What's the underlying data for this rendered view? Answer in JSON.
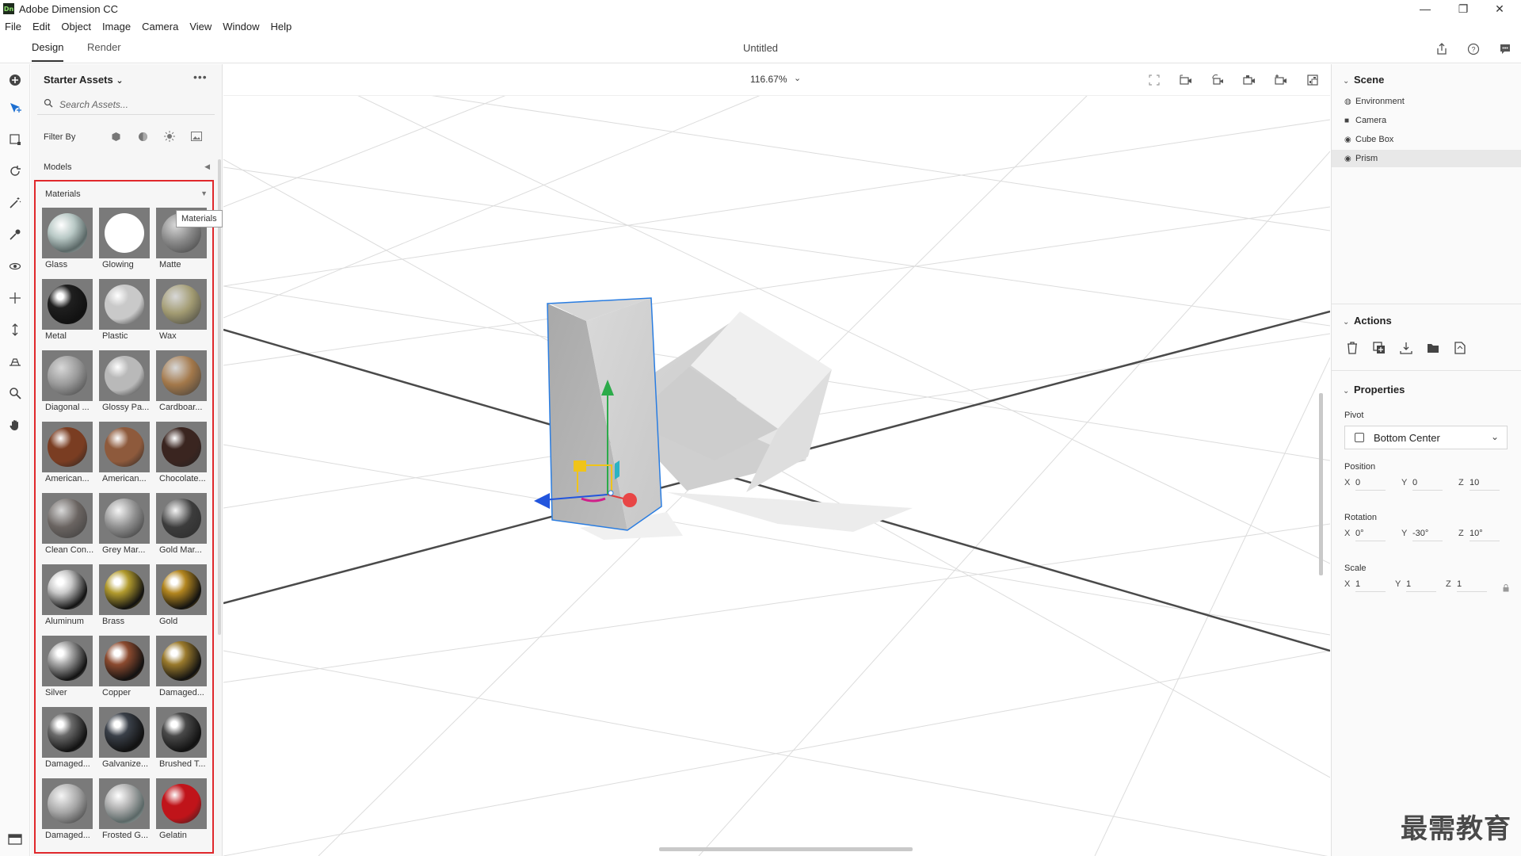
{
  "window": {
    "app_logo": "Dn",
    "title": "Adobe Dimension CC",
    "minimize": "—",
    "maximize": "❐",
    "close": "✕"
  },
  "menu": [
    "File",
    "Edit",
    "Object",
    "Image",
    "Camera",
    "View",
    "Window",
    "Help"
  ],
  "modes": {
    "design": "Design",
    "render": "Render",
    "active": "Design"
  },
  "document": {
    "title": "Untitled"
  },
  "top_icons": [
    "share-icon",
    "help-icon",
    "feedback-icon"
  ],
  "tools": [
    "add-icon",
    "select-icon",
    "transform-icon",
    "rotate-icon",
    "magic-wand-icon",
    "eyedropper-icon",
    "orbit-icon",
    "pan-icon",
    "dolly-icon",
    "horizon-icon",
    "zoom-icon",
    "hand-icon"
  ],
  "assets": {
    "title": "Starter Assets",
    "search_placeholder": "Search Assets...",
    "filter_label": "Filter By",
    "filters": [
      "model-filter-icon",
      "material-filter-icon",
      "light-filter-icon",
      "image-filter-icon"
    ],
    "models_label": "Models",
    "materials_label": "Materials",
    "tooltip": "Materials",
    "materials": [
      {
        "name": "Glass",
        "color": "#b9c9c6",
        "style": "glass"
      },
      {
        "name": "Glowing",
        "color": "#ffffff",
        "style": "glow"
      },
      {
        "name": "Matte",
        "color": "#8a8a8a",
        "style": "matte"
      },
      {
        "name": "Metal",
        "color": "#1f1f1f",
        "style": "metal"
      },
      {
        "name": "Plastic",
        "color": "#c9c9c9",
        "style": "plastic"
      },
      {
        "name": "Wax",
        "color": "#a29b72",
        "style": "matte"
      },
      {
        "name": "Diagonal ...",
        "color": "#9a9a9a",
        "style": "matte"
      },
      {
        "name": "Glossy Pa...",
        "color": "#b9b9b9",
        "style": "plastic"
      },
      {
        "name": "Cardboar...",
        "color": "#a3784a",
        "style": "matte"
      },
      {
        "name": "American...",
        "color": "#7a3d22",
        "style": "plastic"
      },
      {
        "name": "American...",
        "color": "#8e5a3c",
        "style": "plastic"
      },
      {
        "name": "Chocolate...",
        "color": "#3a2520",
        "style": "plastic"
      },
      {
        "name": "Clean Con...",
        "color": "#6a6461",
        "style": "matte"
      },
      {
        "name": "Grey Mar...",
        "color": "#8f8f8f",
        "style": "marble"
      },
      {
        "name": "Gold Mar...",
        "color": "#3c3c3c",
        "style": "marble"
      },
      {
        "name": "Aluminum",
        "color": "#c9c9c9",
        "style": "metal"
      },
      {
        "name": "Brass",
        "color": "#b29b2e",
        "style": "metal"
      },
      {
        "name": "Gold",
        "color": "#b3861f",
        "style": "metal"
      },
      {
        "name": "Silver",
        "color": "#a5a5a5",
        "style": "metal"
      },
      {
        "name": "Copper",
        "color": "#8b4a2f",
        "style": "metal"
      },
      {
        "name": "Damaged...",
        "color": "#9a7a2c",
        "style": "metal"
      },
      {
        "name": "Damaged...",
        "color": "#6a6a6a",
        "style": "metal"
      },
      {
        "name": "Galvanize...",
        "color": "#3a4049",
        "style": "metal"
      },
      {
        "name": "Brushed T...",
        "color": "#4a4a4a",
        "style": "metal"
      },
      {
        "name": "Damaged...",
        "color": "#a6a6a6",
        "style": "marble"
      },
      {
        "name": "Frosted G...",
        "color": "#b2b2b2",
        "style": "glass"
      },
      {
        "name": "Gelatin",
        "color": "#c0141a",
        "style": "plastic"
      }
    ]
  },
  "canvas": {
    "zoom": "116.67%",
    "zoom_caret": "⌄",
    "icons": [
      "frame-icon",
      "camera-fit-icon",
      "camera-rotate-icon",
      "camera-bookmark-icon",
      "camera-add-icon",
      "render-preview-icon"
    ]
  },
  "scene": {
    "title": "Scene",
    "items": [
      {
        "label": "Environment",
        "icon": "environment-icon",
        "glyph": "◍"
      },
      {
        "label": "Camera",
        "icon": "camera-icon",
        "glyph": "■"
      },
      {
        "label": "Cube Box",
        "icon": "model-icon",
        "glyph": "◉"
      },
      {
        "label": "Prism",
        "icon": "model-icon",
        "glyph": "◉",
        "selected": true
      }
    ]
  },
  "actions": {
    "title": "Actions",
    "icons": [
      "delete-icon",
      "duplicate-icon",
      "drop-to-ground-icon",
      "group-icon",
      "export-icon"
    ]
  },
  "properties": {
    "title": "Properties",
    "pivot_label": "Pivot",
    "pivot_value": "Bottom Center",
    "position_label": "Position",
    "position": {
      "x": "0",
      "y": "0",
      "z": "10"
    },
    "rotation_label": "Rotation",
    "rotation": {
      "x": "0°",
      "y": "-30°",
      "z": "10°"
    },
    "scale_label": "Scale",
    "scale": {
      "x": "1",
      "y": "1",
      "z": "1"
    },
    "axes": {
      "x": "X",
      "y": "Y",
      "z": "Z"
    }
  },
  "watermark": "最需教育"
}
